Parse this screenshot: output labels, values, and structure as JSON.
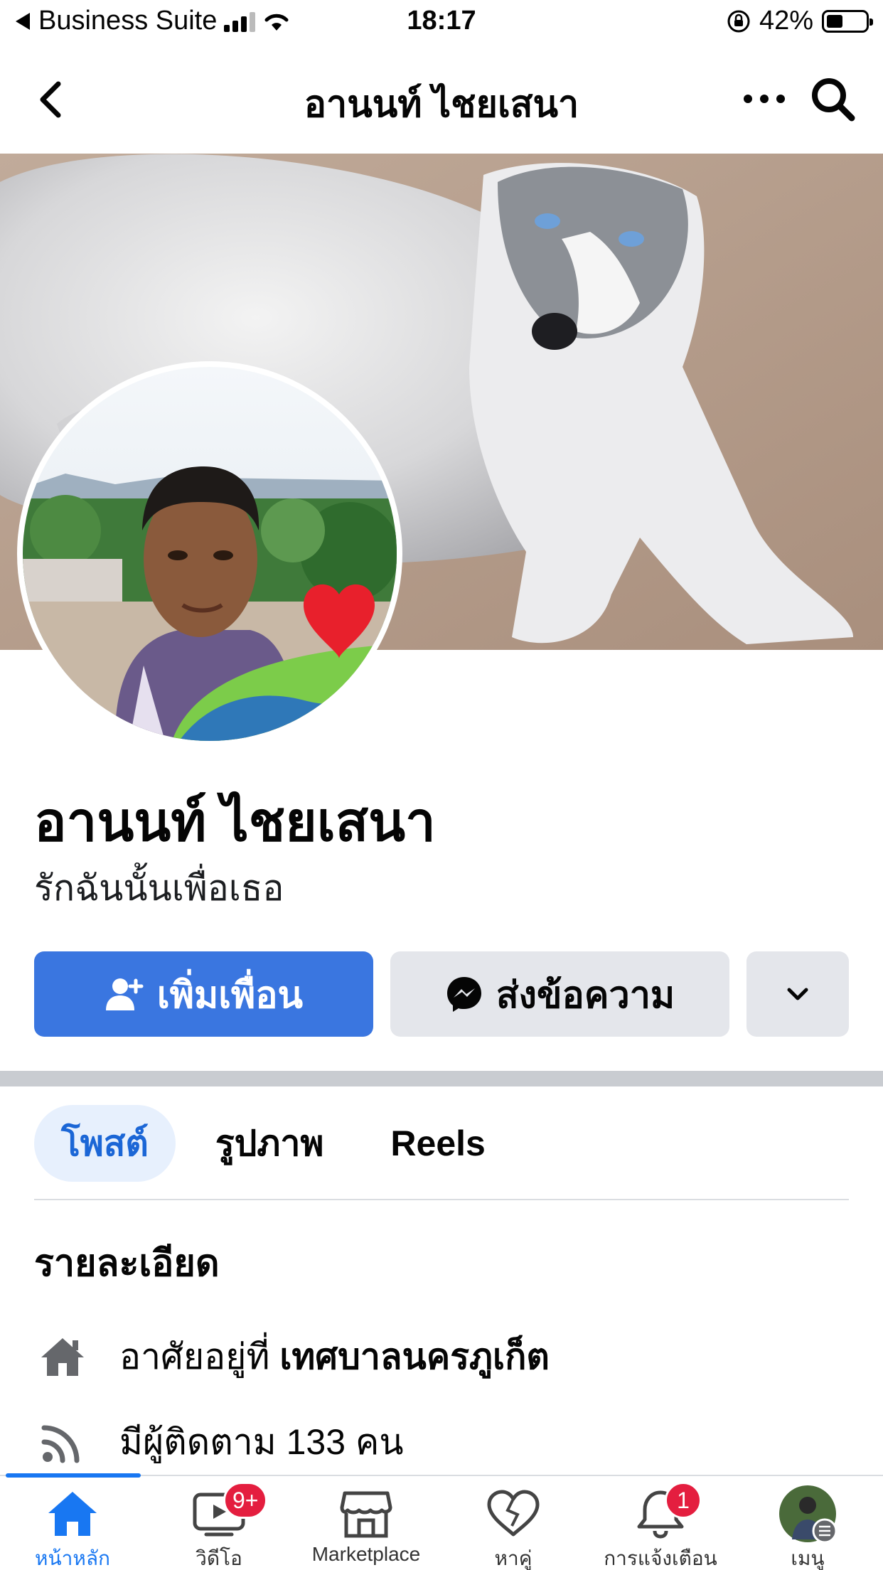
{
  "status_bar": {
    "back_app": "Business Suite",
    "time": "18:17",
    "battery": "42%",
    "battery_level": 0.42
  },
  "header": {
    "title": "อานนท์ ไชยเสนา",
    "back_icon": "chevron-left-icon",
    "more_icon": "ellipsis-icon",
    "search_icon": "search-icon"
  },
  "profile": {
    "name": "อานนท์ ไชยเสนา",
    "bio": "รักฉันนั้นเพื่อเธอ"
  },
  "actions": {
    "add_friend": "เพิ่มเพื่อน",
    "message": "ส่งข้อความ"
  },
  "tabs": [
    {
      "label": "โพสต์",
      "active": true
    },
    {
      "label": "รูปภาพ",
      "active": false
    },
    {
      "label": "Reels",
      "active": false
    }
  ],
  "details": {
    "title": "รายละเอียด",
    "lives_prefix": "อาศัยอยู่ที่ ",
    "lives_place": "เทศบาลนครภูเก็ต",
    "followers_prefix": "มีผู้ติดตาม ",
    "followers_count": "133 คน"
  },
  "bottom_nav": {
    "home": "หน้าหลัก",
    "video": "วิดีโอ",
    "video_badge": "9+",
    "marketplace": "Marketplace",
    "dating": "หาคู่",
    "notifications": "การแจ้งเตือน",
    "notifications_badge": "1",
    "menu": "เมนู"
  },
  "colors": {
    "accent": "#3a76e0",
    "badge": "#e41e3f",
    "active_tab_bg": "#e7f0fd"
  }
}
